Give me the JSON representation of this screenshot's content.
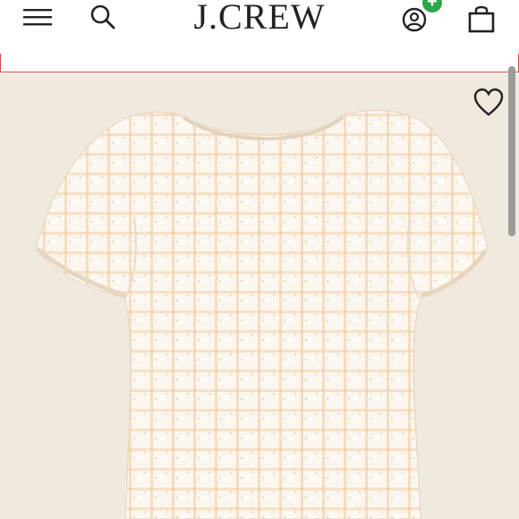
{
  "header": {
    "brand": "J.CREW",
    "icons": {
      "menu": "hamburger-menu-icon",
      "search": "search-icon",
      "account": "account-icon",
      "account_badge": "+",
      "bag": "shopping-bag-icon"
    }
  },
  "product": {
    "image": "puff-sleeve-gingham-top",
    "favorite_icon": "heart-icon"
  },
  "colors": {
    "badge_green": "#2aa84a",
    "promo_border": "#d64a43",
    "image_background": "#efe9de",
    "gingham_accent": "#f0c89a"
  }
}
